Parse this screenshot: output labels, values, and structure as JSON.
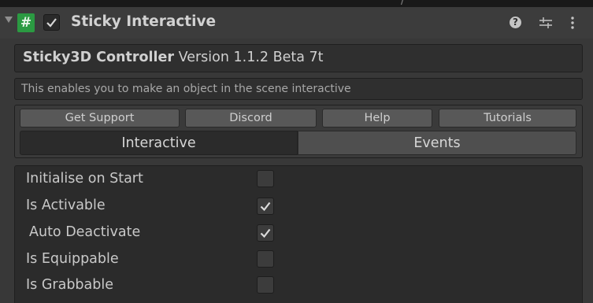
{
  "header": {
    "component_title": "Sticky Interactive",
    "enabled": true,
    "icons": [
      "script-icon",
      "help-icon",
      "preset-icon",
      "kebab-menu-icon"
    ]
  },
  "top_strip": {
    "tail_text": "/"
  },
  "version_box": {
    "product": "Sticky3D Controller",
    "version": "Version 1.1.2 Beta 7t"
  },
  "description": "This enables you to make an object in the scene interactive",
  "links": {
    "get_support": "Get Support",
    "discord": "Discord",
    "help": "Help",
    "tutorials": "Tutorials"
  },
  "tabs": {
    "interactive": "Interactive",
    "events": "Events",
    "selected": "Interactive"
  },
  "settings": [
    {
      "label": "Initialise on Start",
      "checked": false
    },
    {
      "label": "Is Activable",
      "checked": true
    },
    {
      "label": "Auto Deactivate",
      "checked": true
    },
    {
      "label": "Is Equippable",
      "checked": false
    },
    {
      "label": "Is Grabbable",
      "checked": false
    }
  ],
  "colors": {
    "script_icon": "#2b9a42",
    "background": "#383838",
    "panel": "#2b2b2b"
  }
}
